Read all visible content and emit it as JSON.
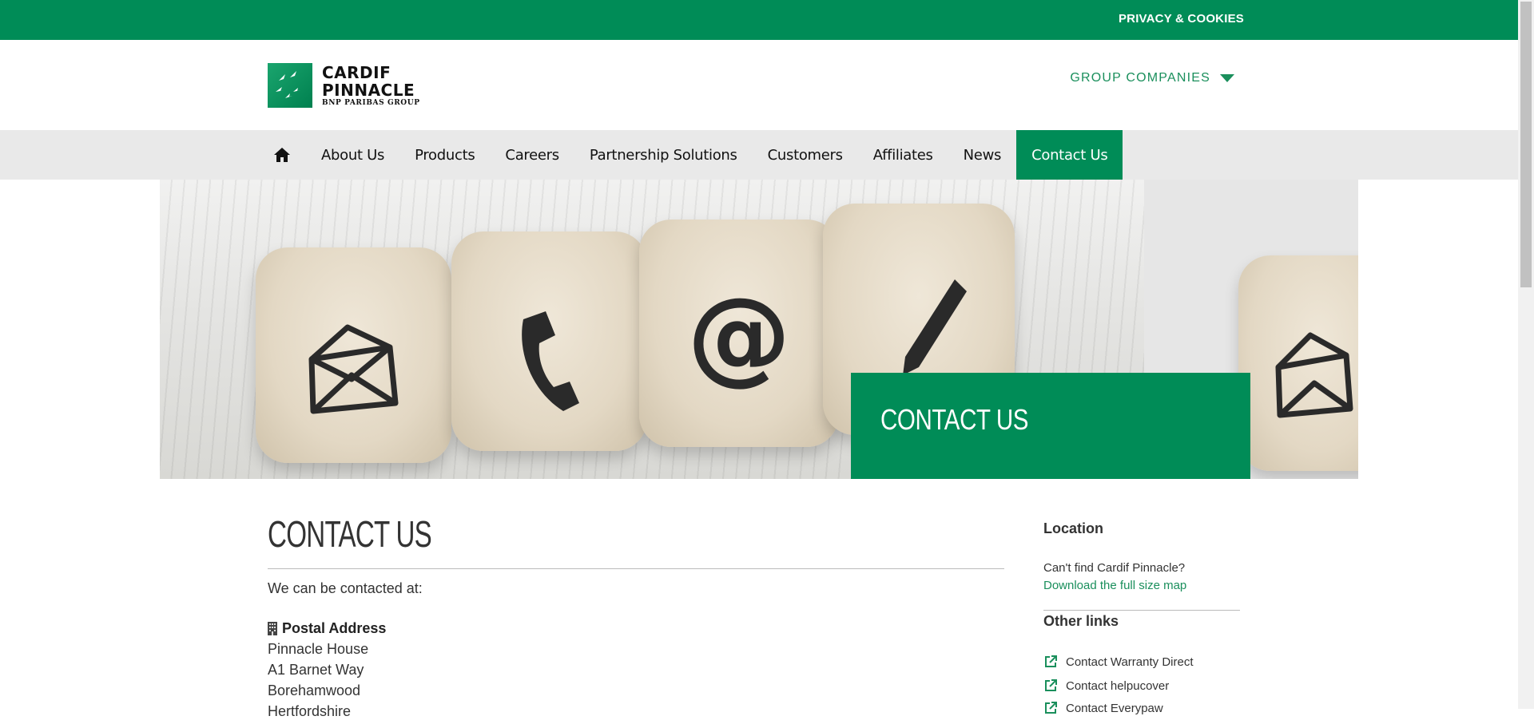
{
  "topbar": {
    "privacy_label": "PRIVACY & COOKIES"
  },
  "logo": {
    "name": "CARDIF PINNACLE",
    "sub": "BNP PARIBAS GROUP"
  },
  "header": {
    "group_companies": "GROUP COMPANIES"
  },
  "nav": {
    "items": [
      {
        "label": "About Us"
      },
      {
        "label": "Products"
      },
      {
        "label": "Careers"
      },
      {
        "label": "Partnership Solutions"
      },
      {
        "label": "Customers"
      },
      {
        "label": "Affiliates"
      },
      {
        "label": "News"
      },
      {
        "label": "Contact Us"
      }
    ]
  },
  "hero": {
    "banner_title": "CONTACT US"
  },
  "main": {
    "title": "CONTACT US",
    "intro": "We can be contacted at:",
    "postal_heading": "Postal Address",
    "address_lines": [
      "Pinnacle House",
      "A1 Barnet Way",
      "Borehamwood",
      "Hertfordshire"
    ]
  },
  "sidebar": {
    "location_heading": "Location",
    "cant_find": "Can't find Cardif Pinnacle?",
    "map_link": "Download the full size map",
    "other_links_heading": "Other links",
    "links": [
      {
        "label": "Contact Warranty Direct"
      },
      {
        "label": "Contact helpucover"
      },
      {
        "label": "Contact Everypaw"
      }
    ]
  },
  "colors": {
    "brand_green": "#008c57",
    "link_green": "#1a8f5c",
    "nav_bg": "#e9e9e9"
  }
}
